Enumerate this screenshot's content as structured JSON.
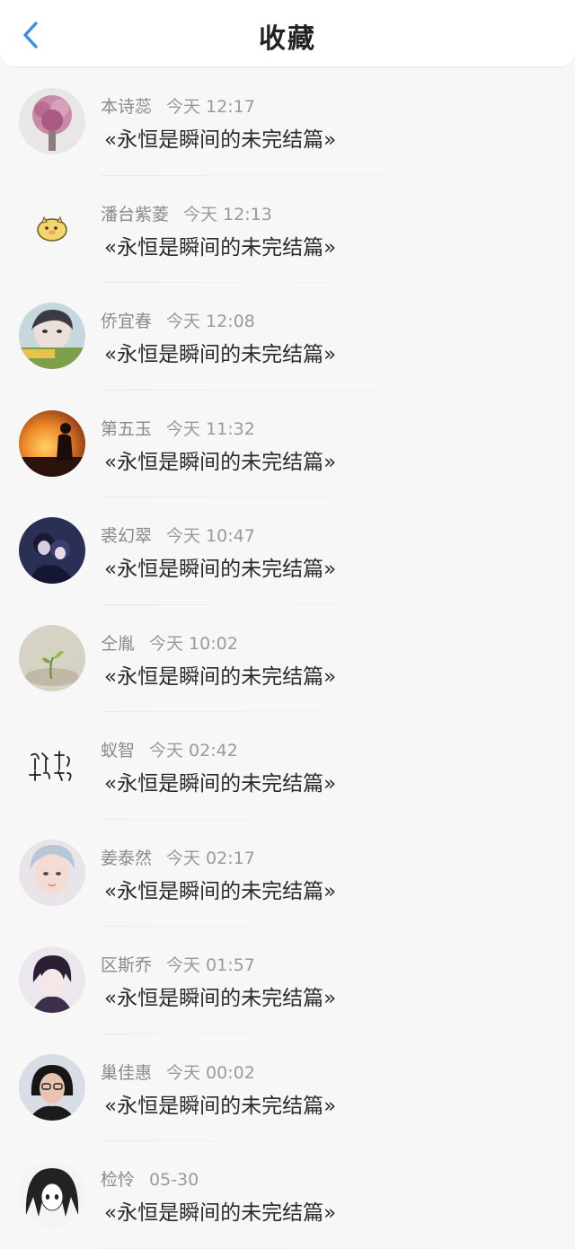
{
  "header": {
    "title": "收藏",
    "accent_color": "#3a8ee6"
  },
  "items": [
    {
      "name": "本诗蕊",
      "time": "今天 12:17",
      "message": "«永恒是瞬间的未完结篇»",
      "avatar": "pink-flower-bouquet"
    },
    {
      "name": "潘台紫菱",
      "time": "今天 12:13",
      "message": "«永恒是瞬间的未完结篇»",
      "avatar": "cartoon-pig-sticker"
    },
    {
      "name": "侨宜春",
      "time": "今天 12:08",
      "message": "«永恒是瞬间的未完结篇»",
      "avatar": "girl-selfie"
    },
    {
      "name": "第五玉",
      "time": "今天 11:32",
      "message": "«永恒是瞬间的未完结篇»",
      "avatar": "sunset-silhouette"
    },
    {
      "name": "裘幻翠",
      "time": "今天 10:47",
      "message": "«永恒是瞬间的未完结篇»",
      "avatar": "anime-couple"
    },
    {
      "name": "仝胤",
      "time": "今天 10:02",
      "message": "«永恒是瞬间的未完结篇»",
      "avatar": "sprout-in-sand"
    },
    {
      "name": "蚁智",
      "time": "今天 02:42",
      "message": "«永恒是瞬间的未完结篇»",
      "avatar": "calligraphy-text"
    },
    {
      "name": "姜泰然",
      "time": "今天 02:17",
      "message": "«永恒是瞬间的未完结篇»",
      "avatar": "illustrated-boy"
    },
    {
      "name": "区斯乔",
      "time": "今天 01:57",
      "message": "«永恒是瞬间的未完结篇»",
      "avatar": "anime-dark-hair"
    },
    {
      "name": "巢佳惠",
      "time": "今天 00:02",
      "message": "«永恒是瞬间的未完结篇»",
      "avatar": "girl-with-glasses"
    },
    {
      "name": "检怜",
      "time": "05-30",
      "message": "«永恒是瞬间的未完结篇»",
      "avatar": "manga-girl"
    }
  ]
}
